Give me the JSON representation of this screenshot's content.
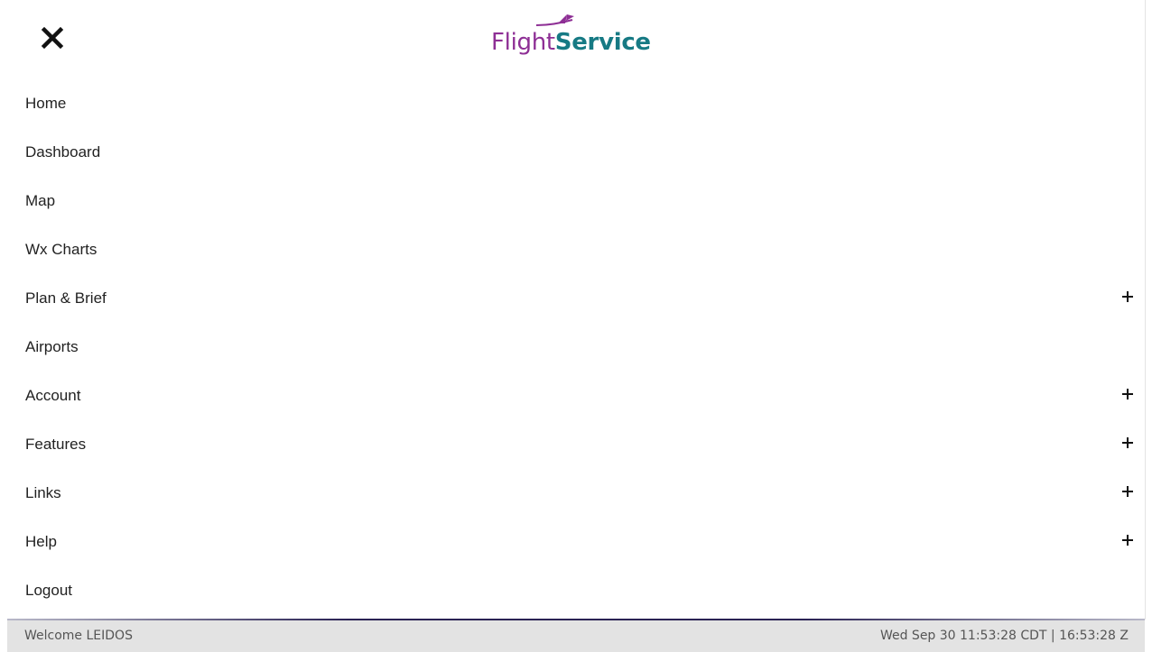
{
  "header": {
    "close_icon": "close-icon",
    "logo": {
      "part1": "Flight",
      "part2": "Service",
      "color1": "#8e2f95",
      "color2": "#167a84"
    }
  },
  "nav": {
    "items": [
      {
        "label": "Home",
        "expandable": false
      },
      {
        "label": "Dashboard",
        "expandable": false
      },
      {
        "label": "Map",
        "expandable": false
      },
      {
        "label": "Wx Charts",
        "expandable": false
      },
      {
        "label": "Plan & Brief",
        "expandable": true
      },
      {
        "label": "Airports",
        "expandable": false
      },
      {
        "label": "Account",
        "expandable": true
      },
      {
        "label": "Features",
        "expandable": true
      },
      {
        "label": "Links",
        "expandable": true
      },
      {
        "label": "Help",
        "expandable": true
      },
      {
        "label": "Logout",
        "expandable": false
      }
    ],
    "expand_icon": "plus-icon"
  },
  "footer": {
    "welcome_label": "Welcome",
    "username": "LEIDOS",
    "datetime": "Wed Sep 30 11:53:28 CDT | 16:53:28 Z"
  }
}
